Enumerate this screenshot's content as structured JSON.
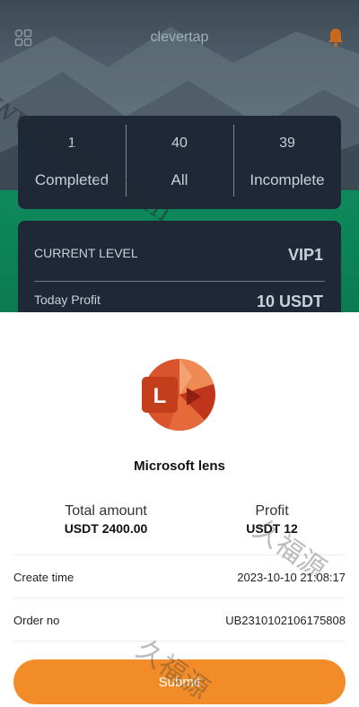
{
  "header": {
    "title": "clevertap"
  },
  "stats": [
    {
      "value": "1",
      "label": "Completed"
    },
    {
      "value": "40",
      "label": "All"
    },
    {
      "value": "39",
      "label": "Incomplete"
    }
  ],
  "level": {
    "label": "CURRENT LEVEL",
    "value": "VIP1",
    "profit_label": "Today Profit",
    "profit_value": "10 USDT"
  },
  "sheet": {
    "app_name": "Microsoft lens",
    "logo_letter": "L",
    "total_label": "Total amount",
    "total_value": "USDT 2400.00",
    "profit_label": "Profit",
    "profit_value": "USDT 12",
    "create_time_label": "Create time",
    "create_time_value": "2023-10-10 21:08:17",
    "order_no_label": "Order no",
    "order_no_value": "UB2310102106175808",
    "submit_label": "Submit"
  },
  "watermarks": {
    "site": "www.9fym.com",
    "chinese": "久福源"
  },
  "colors": {
    "card_bg": "#1e2836",
    "accent_orange": "#f28c28",
    "green_band": "#0e8a5d"
  },
  "icons": {
    "menu": "grid-icon",
    "notification": "bell-icon"
  }
}
